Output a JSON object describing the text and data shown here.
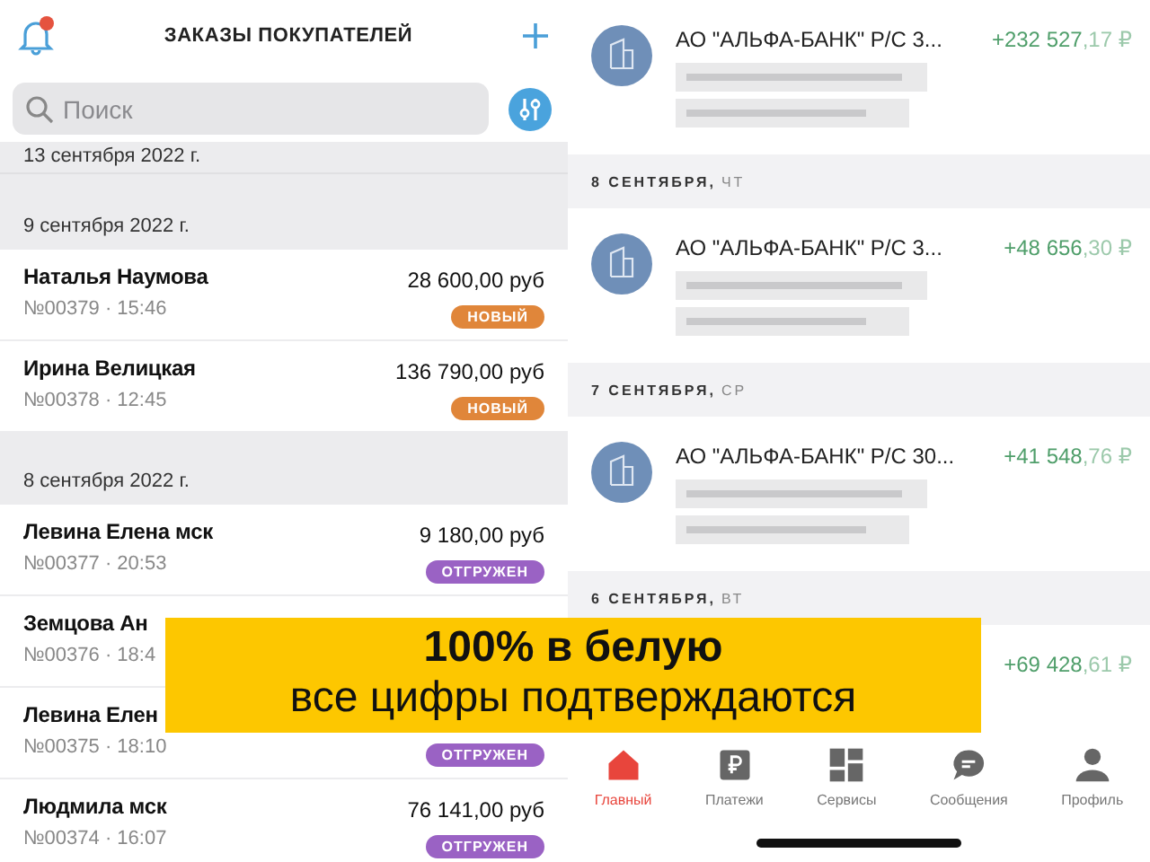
{
  "orders_screen": {
    "title": "ЗАКАЗЫ ПОКУПАТЕЛЕЙ",
    "notifications_unread": true,
    "search": {
      "placeholder": "Поиск"
    },
    "groups": [
      {
        "date": "13 сентября 2022 г."
      },
      {
        "date": "9 сентября 2022 г.",
        "orders": [
          {
            "name": "Наталья Наумова",
            "meta": "№00379 · 15:46",
            "amount": "28 600,00 руб",
            "status": {
              "label": "НОВЫЙ",
              "kind": "new"
            }
          },
          {
            "name": "Ирина Велицкая",
            "meta": "№00378 · 12:45",
            "amount": "136 790,00 руб",
            "status": {
              "label": "НОВЫЙ",
              "kind": "new"
            }
          }
        ]
      },
      {
        "date": "8 сентября 2022 г.",
        "orders": [
          {
            "name": "Левина Елена мск",
            "meta": "№00377 · 20:53",
            "amount": "9 180,00 руб",
            "status": {
              "label": "ОТГРУЖЕН",
              "kind": "shipped"
            }
          },
          {
            "name": "Земцова Ан",
            "meta": "№00376 · 18:4"
          },
          {
            "name": "Левина Елен",
            "meta": "№00375 · 18:10",
            "status": {
              "label": "ОТГРУЖЕН",
              "kind": "shipped"
            }
          },
          {
            "name": "Людмила мск",
            "meta": "№00374 · 16:07",
            "amount": "76 141,00 руб",
            "status": {
              "label": "ОТГРУЖЕН",
              "kind": "shipped"
            }
          }
        ]
      }
    ]
  },
  "bank_screen": {
    "groups": [
      {
        "items": [
          {
            "title": "АО \"АЛЬФА-БАНК\" Р/С 3...",
            "amount_main": "+232 527",
            "amount_fraction": ",17 ₽"
          }
        ]
      },
      {
        "date": "8 СЕНТЯБРЯ,",
        "weekday": "ЧТ",
        "items": [
          {
            "title": "АО \"АЛЬФА-БАНК\" Р/С 3...",
            "amount_main": "+48 656",
            "amount_fraction": ",30 ₽"
          }
        ]
      },
      {
        "date": "7 СЕНТЯБРЯ,",
        "weekday": "СР",
        "items": [
          {
            "title": "АО \"АЛЬФА-БАНК\" Р/С 30...",
            "amount_main": "+41 548",
            "amount_fraction": ",76 ₽"
          }
        ]
      },
      {
        "date": "6 СЕНТЯБРЯ,",
        "weekday": "ВТ",
        "items": [
          {
            "amount_main": "+69 428",
            "amount_fraction": ",61 ₽"
          }
        ]
      }
    ],
    "nav": [
      {
        "label": "Главный",
        "selected": true
      },
      {
        "label": "Платежи",
        "selected": false
      },
      {
        "label": "Сервисы",
        "selected": false
      },
      {
        "label": "Сообщения",
        "selected": false
      },
      {
        "label": "Профиль",
        "selected": false
      }
    ]
  },
  "banner": {
    "title": "100% в белую",
    "subtitle": "все цифры подтверждаются"
  }
}
